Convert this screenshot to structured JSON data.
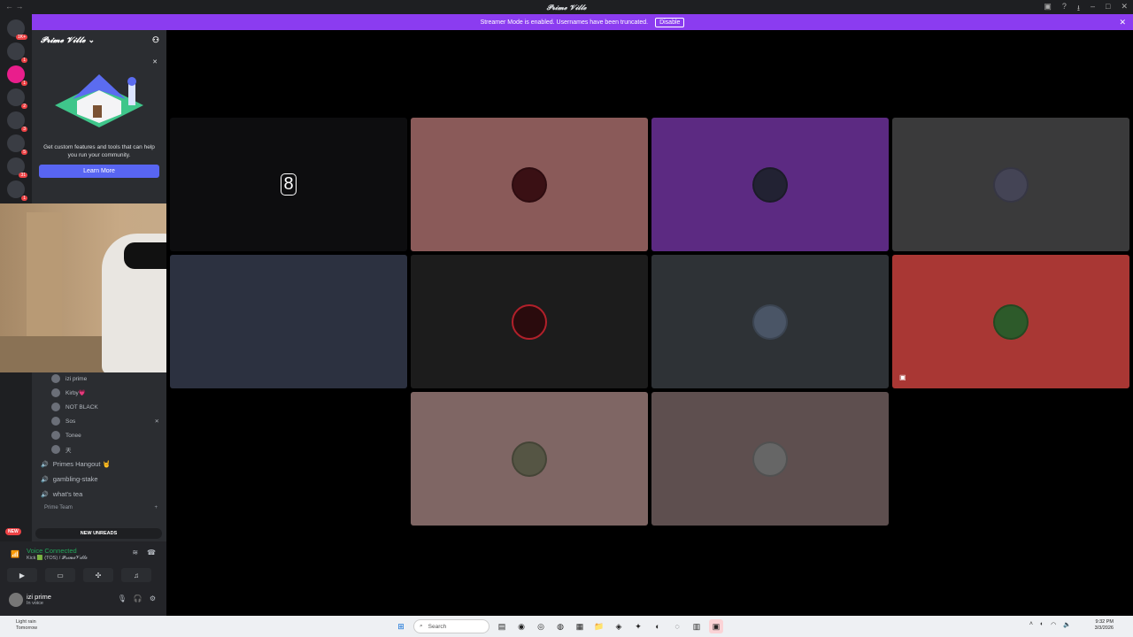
{
  "window": {
    "title": "𝓟𝓻𝓲𝓶𝓮 𝓥𝓲𝓵𝓵𝓮"
  },
  "banner": {
    "text": "Streamer Mode is enabled. Usernames have been truncated.",
    "button": "Disable",
    "close": "✕"
  },
  "servers": [
    {
      "badge": "1K+"
    },
    {
      "badge": "1"
    },
    {
      "badge": "1"
    },
    {
      "badge": "2"
    },
    {
      "badge": "3"
    },
    {
      "badge": "5"
    },
    {
      "badge": "31"
    },
    {
      "badge": "1"
    },
    {
      "badge": "1"
    }
  ],
  "guild": {
    "name": "𝓟𝓻𝓲𝓶𝓮 𝓥𝓲𝓵𝓵𝓮",
    "chevron": "⌄"
  },
  "promo": {
    "text": "Get custom features and tools that can help you run your community.",
    "button": "Learn More",
    "close": "✕"
  },
  "voice_users": [
    {
      "name": "izi prime"
    },
    {
      "name": "Kirby💗"
    },
    {
      "name": "NOT BLACK"
    },
    {
      "name": "Sos"
    },
    {
      "name": "Tonee"
    },
    {
      "name": "天"
    }
  ],
  "channels": [
    {
      "name": "Primes Hangout 🤘"
    },
    {
      "name": "gambling-stake"
    },
    {
      "name": "what's tea"
    }
  ],
  "category": {
    "name": "Prime Team"
  },
  "unreads": {
    "label": "NEW UNREADS",
    "badge": "NEW"
  },
  "voice_panel": {
    "status": "Voice Connected",
    "subtitle": "Kick 🟩 (TOS) / 𝓟𝓻𝓲𝓶𝓮𝓥𝓲𝓵𝓵𝓮"
  },
  "user_panel": {
    "name": "izi prime",
    "status": "In voice"
  },
  "tiles": [
    {
      "color": "#0d0d0f"
    },
    {
      "color": "#8a5a59"
    },
    {
      "color": "#5c2a82"
    },
    {
      "color": "#3a3a3b"
    },
    {
      "color": "#2c3140"
    },
    {
      "color": "#1c1c1c"
    },
    {
      "color": "#2e3236"
    },
    {
      "color": "#a93734"
    },
    {
      "color": "#7f6664"
    },
    {
      "color": "#5e4f4f"
    }
  ],
  "taskbar": {
    "weather": "Light rain",
    "weather_sub": "Tomorrow",
    "search": "Search",
    "time": "9:32 PM",
    "date": "3/3/2026"
  }
}
